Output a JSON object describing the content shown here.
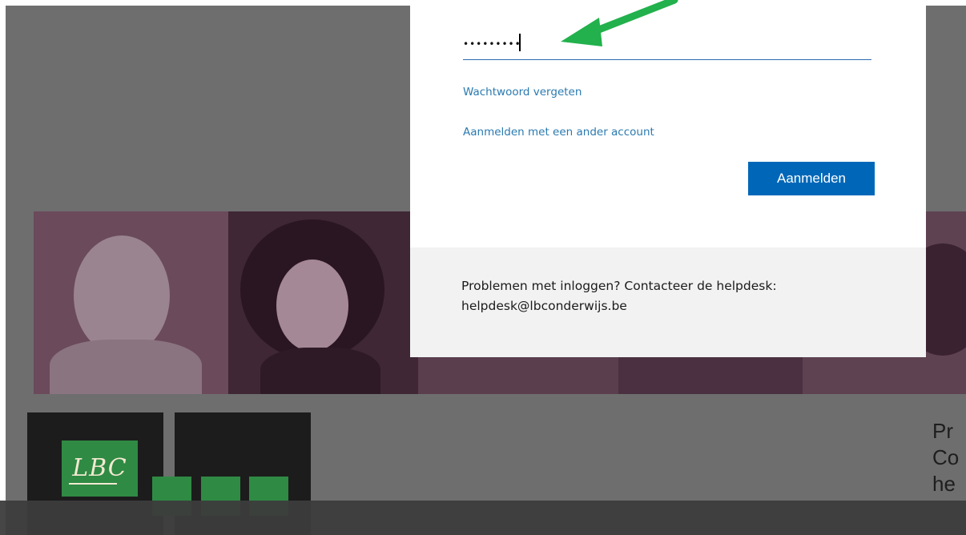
{
  "login": {
    "password_value": "•••••••••",
    "forgot_password_link": "Wachtwoord vergeten",
    "other_account_link": "Aanmelden met een ander account",
    "signin_button": "Aanmelden",
    "help_line_1": "Problemen met inloggen? Contacteer de helpdesk:",
    "help_line_2": "helpdesk@lbconderwijs.be"
  },
  "background": {
    "logo_text": "LBC",
    "side_text_lines": [
      "Pr",
      "Co",
      "he"
    ]
  },
  "annotation": {
    "arrow_color": "#22b14c"
  },
  "colors": {
    "accent": "#0067b8",
    "link": "#2a7ab0",
    "brand_green": "#2f8a44"
  }
}
